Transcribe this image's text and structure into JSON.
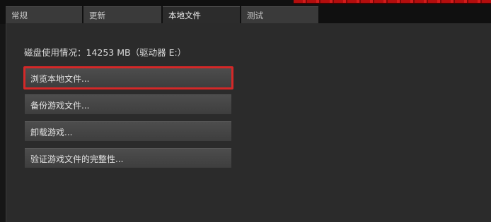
{
  "tabs": [
    {
      "label": "常规",
      "active": false
    },
    {
      "label": "更新",
      "active": false
    },
    {
      "label": "本地文件",
      "active": true
    },
    {
      "label": "测试",
      "active": false
    }
  ],
  "disk_usage_text": "磁盘使用情况：14253 MB（驱动器 E:）",
  "buttons": {
    "browse": "浏览本地文件...",
    "backup": "备份游戏文件...",
    "uninstall": "卸载游戏...",
    "verify": "验证游戏文件的完整性..."
  },
  "colors": {
    "highlight": "#d42828",
    "panel": "#2b2b2b",
    "button": "#474747"
  }
}
